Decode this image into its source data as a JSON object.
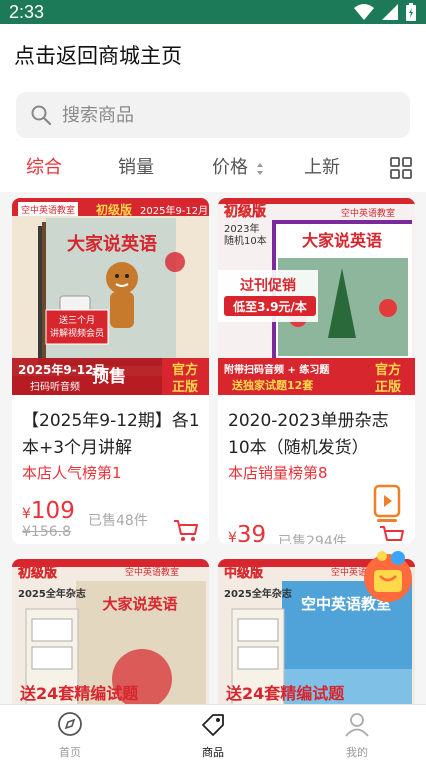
{
  "status": {
    "time": "2:33"
  },
  "header": {
    "title": "点击返回商城主页"
  },
  "search": {
    "placeholder": "搜索商品"
  },
  "sort": {
    "tabs": [
      {
        "label": "综合",
        "active": true
      },
      {
        "label": "销量"
      },
      {
        "label": "价格"
      },
      {
        "label": "上新"
      }
    ]
  },
  "products": [
    {
      "title": "【2025年9-12期】各1本+3个月讲解",
      "rank": "本店人气榜第1",
      "price": "109",
      "currency": "¥",
      "sold": "已售48件",
      "original_price": "¥156.8",
      "cover": {
        "brand": "空中英语教室",
        "level": "初级版",
        "issue": "2025年9-12月",
        "magazine": "大家说英语",
        "gift": "送三个月讲解视频会员",
        "banner": "2025年9-12月",
        "scan": "扫码听音频",
        "presale": "预售",
        "official": "官方正版"
      }
    },
    {
      "title": "2020-2023单册杂志10本（随机发货）",
      "rank": "本店销量榜第8",
      "price": "39",
      "currency": "¥",
      "sold": "已售294件",
      "cover": {
        "brand": "空中英语教室",
        "level": "初级版",
        "issue": "2023年 随机10本",
        "magazine": "大家说英语",
        "promo_line1": "过刊促销",
        "promo_line2": "低至3.9元/本",
        "bottom1": "附带扫码音频 + 练习题",
        "bottom2": "送独家试题12套",
        "official": "官方正版"
      }
    },
    {
      "cover": {
        "brand": "空中英语教室",
        "level": "初级版",
        "issue": "2025全年杂志",
        "magazine": "大家说英语",
        "gift": "送24套精编试题"
      }
    },
    {
      "cover": {
        "brand": "空中英语教室",
        "level": "中级版",
        "issue": "2025全年杂志",
        "magazine": "空中英语教室",
        "gift": "送24套精编试题"
      }
    }
  ],
  "nav": {
    "items": [
      {
        "label": "首页",
        "icon": "compass-icon"
      },
      {
        "label": "商品",
        "icon": "tag-icon",
        "active": true
      },
      {
        "label": "我的",
        "icon": "user-icon"
      }
    ]
  },
  "colors": {
    "accent": "#e8333a",
    "status_bar": "#1d7a58",
    "cover_red": "#d7262e",
    "cover_yellow": "#ffd94a"
  }
}
